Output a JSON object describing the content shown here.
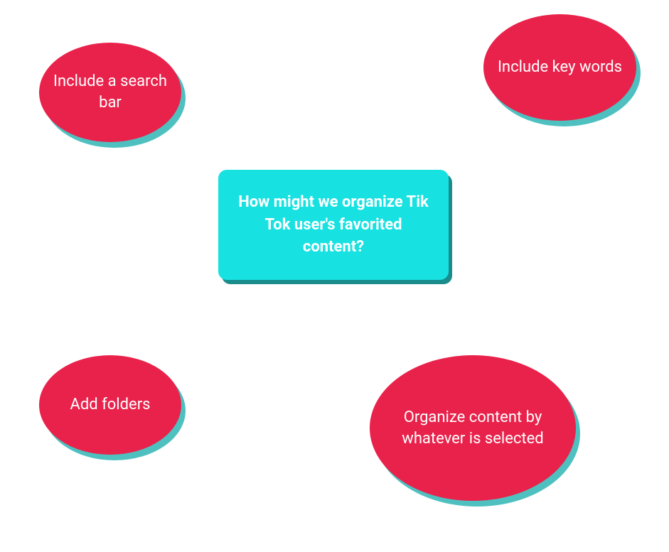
{
  "central": {
    "text": "How might we organize Tik Tok user's favorited content?"
  },
  "bubbles": {
    "topLeft": "Include a search bar",
    "topRight": "Include key words",
    "bottomLeft": "Add folders",
    "bottomRight": "Organize content by whatever is selected"
  },
  "colors": {
    "bubbleFill": "#e9224b",
    "bubbleShadow": "#4fc0c0",
    "centralFill": "#18e1e1",
    "centralShadow": "#1a8c8c",
    "text": "#ffffff"
  }
}
